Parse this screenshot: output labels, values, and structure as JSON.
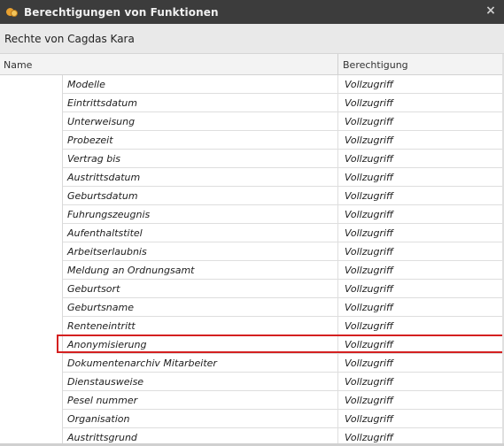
{
  "window": {
    "title": "Berechtigungen von Funktionen",
    "icon": "app-people-icon",
    "close_glyph": "×"
  },
  "subheader": {
    "text": "Rechte von Cagdas Kara"
  },
  "columns": {
    "name": "Name",
    "permission": "Berechtigung"
  },
  "rows": [
    {
      "name": "Modelle",
      "permission": "Vollzugriff"
    },
    {
      "name": "Eintrittsdatum",
      "permission": "Vollzugriff"
    },
    {
      "name": "Unterweisung",
      "permission": "Vollzugriff"
    },
    {
      "name": "Probezeit",
      "permission": "Vollzugriff"
    },
    {
      "name": "Vertrag bis",
      "permission": "Vollzugriff"
    },
    {
      "name": "Austrittsdatum",
      "permission": "Vollzugriff"
    },
    {
      "name": "Geburtsdatum",
      "permission": "Vollzugriff"
    },
    {
      "name": "Fuhrungszeugnis",
      "permission": "Vollzugriff"
    },
    {
      "name": "Aufenthaltstitel",
      "permission": "Vollzugriff"
    },
    {
      "name": "Arbeitserlaubnis",
      "permission": "Vollzugriff"
    },
    {
      "name": "Meldung an Ordnungsamt",
      "permission": "Vollzugriff"
    },
    {
      "name": "Geburtsort",
      "permission": "Vollzugriff"
    },
    {
      "name": "Geburtsname",
      "permission": "Vollzugriff"
    },
    {
      "name": "Renteneintritt",
      "permission": "Vollzugriff"
    },
    {
      "name": "Anonymisierung",
      "permission": "Vollzugriff"
    },
    {
      "name": "Dokumentenarchiv Mitarbeiter",
      "permission": "Vollzugriff"
    },
    {
      "name": "Dienstausweise",
      "permission": "Vollzugriff"
    },
    {
      "name": "Pesel nummer",
      "permission": "Vollzugriff"
    },
    {
      "name": "Organisation",
      "permission": "Vollzugriff"
    },
    {
      "name": "Austrittsgrund",
      "permission": "Vollzugriff"
    }
  ],
  "highlighted_row": "Anonymisierung",
  "colors": {
    "titlebar": "#3c3c3c",
    "highlight_border": "#d42020"
  }
}
